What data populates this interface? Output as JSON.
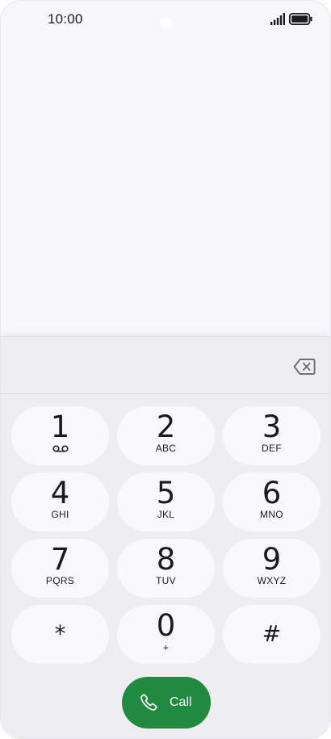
{
  "status_bar": {
    "time": "10:00"
  },
  "dialer": {
    "number": "",
    "keys": [
      {
        "digit": "1",
        "letters": ""
      },
      {
        "digit": "2",
        "letters": "ABC"
      },
      {
        "digit": "3",
        "letters": "DEF"
      },
      {
        "digit": "4",
        "letters": "GHI"
      },
      {
        "digit": "5",
        "letters": "JKL"
      },
      {
        "digit": "6",
        "letters": "MNO"
      },
      {
        "digit": "7",
        "letters": "PQRS"
      },
      {
        "digit": "8",
        "letters": "TUV"
      },
      {
        "digit": "9",
        "letters": "WXYZ"
      },
      {
        "digit": "*",
        "letters": ""
      },
      {
        "digit": "0",
        "letters": "+"
      },
      {
        "digit": "#",
        "letters": ""
      }
    ],
    "call_label": "Call"
  },
  "colors": {
    "call_button": "#208a40",
    "background": "#f7f7fc",
    "dialer_panel": "#ededf2",
    "key": "#f9f9fc"
  },
  "icons": {
    "signal": "signal-icon",
    "battery": "battery-icon",
    "backspace": "backspace-icon",
    "voicemail": "voicemail-icon",
    "call": "phone-icon"
  }
}
